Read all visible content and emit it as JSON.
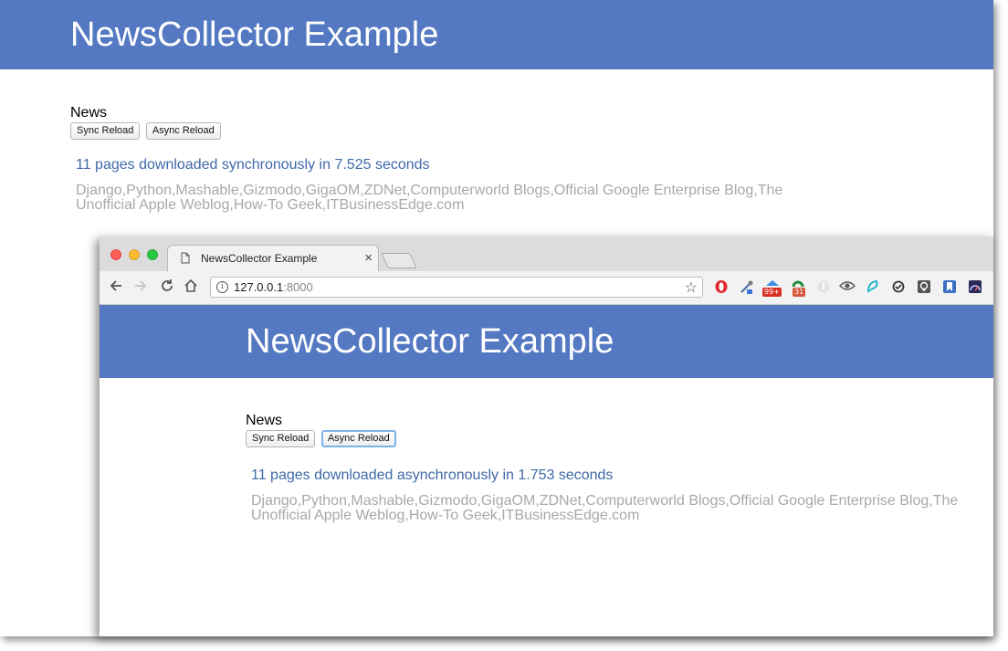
{
  "back": {
    "banner_title": "NewsCollector Example",
    "section_title": "News",
    "sync_button": "Sync Reload",
    "async_button": "Async Reload",
    "result_text": "11 pages downloaded synchronously in 7.525 seconds",
    "sources_text": "Django,Python,Mashable,Gizmodo,GigaOM,ZDNet,Computerworld Blogs,Official Google Enterprise Blog,The Unofficial Apple Weblog,How-To Geek,ITBusinessEdge.com"
  },
  "front": {
    "tab_title": "NewsCollector Example",
    "tab_close": "×",
    "url_host": "127.0.0.1",
    "url_port": ":8000",
    "banner_title": "NewsCollector Example",
    "section_title": "News",
    "sync_button": "Sync Reload",
    "async_button": "Async Reload",
    "result_text": "11 pages downloaded asynchronously in 1.753 seconds",
    "sources_text": "Django,Python,Mashable,Gizmodo,GigaOM,ZDNet,Computerworld Blogs,Official Google Enterprise Blog,The Unofficial Apple Weblog,How-To Geek,ITBusinessEdge.com"
  },
  "extensions": {
    "badge_1": "99+",
    "badge_2": "31"
  },
  "colors": {
    "banner": "#5479c2",
    "result_link": "#3f69a9",
    "sources_gray": "#a8a8a8"
  }
}
